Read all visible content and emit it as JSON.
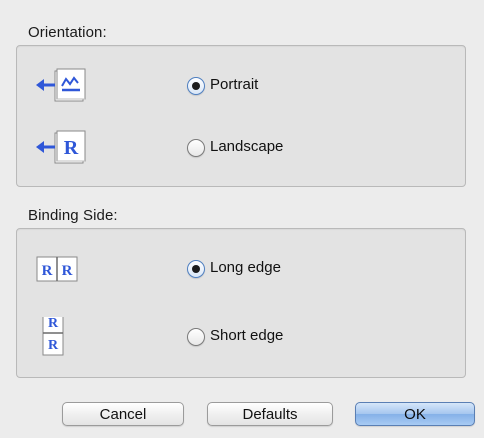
{
  "orientation": {
    "title": "Orientation:",
    "options": [
      {
        "label": "Portrait",
        "checked": true,
        "icon": "portrait-orientation-icon"
      },
      {
        "label": "Landscape",
        "checked": false,
        "icon": "landscape-orientation-icon"
      }
    ]
  },
  "binding": {
    "title": "Binding Side:",
    "options": [
      {
        "label": "Long edge",
        "checked": true,
        "icon": "long-edge-binding-icon"
      },
      {
        "label": "Short edge",
        "checked": false,
        "icon": "short-edge-binding-icon"
      }
    ]
  },
  "icon_letters": {
    "R": "R"
  },
  "buttons": {
    "cancel": "Cancel",
    "defaults": "Defaults",
    "ok": "OK"
  },
  "colors": {
    "accent_blue": "#2f57d8",
    "group_bg": "#e3e3e3",
    "window_bg": "#ececec"
  }
}
